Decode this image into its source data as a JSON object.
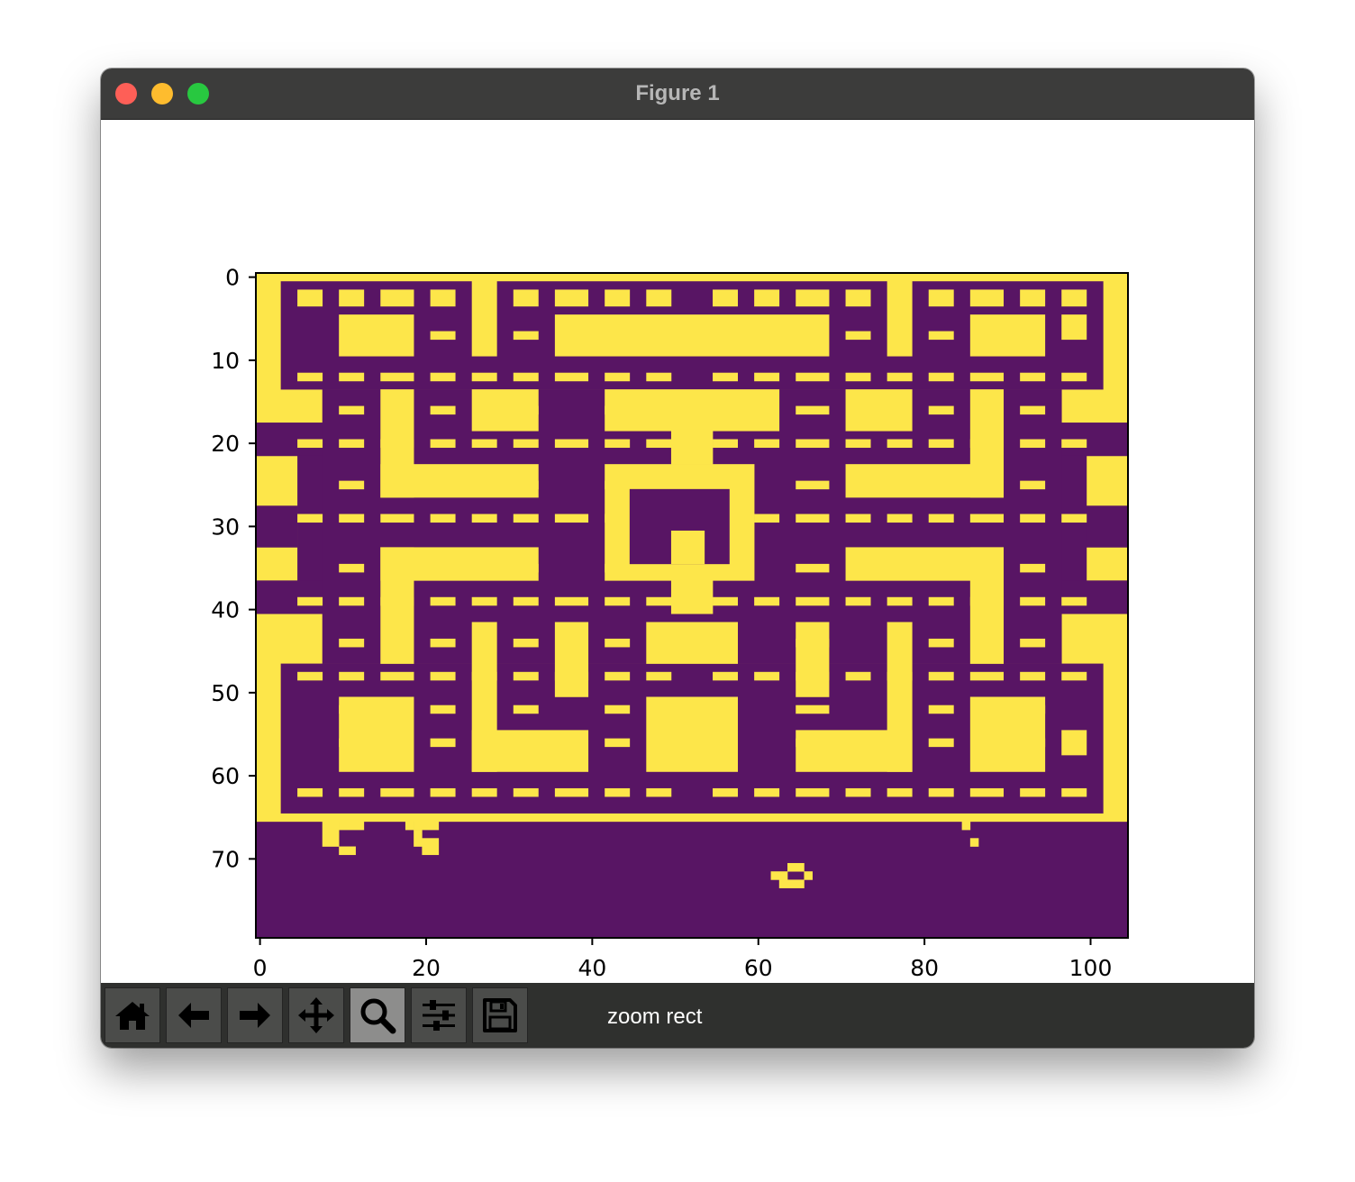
{
  "window": {
    "title": "Figure 1"
  },
  "toolbar": {
    "buttons": [
      {
        "icon": "home-icon",
        "active": false
      },
      {
        "icon": "back-arrow-icon",
        "active": false
      },
      {
        "icon": "forward-arrow-icon",
        "active": false
      },
      {
        "icon": "pan-move-icon",
        "active": false
      },
      {
        "icon": "zoom-magnifier-icon",
        "active": true
      },
      {
        "icon": "configure-subplots-icon",
        "active": false
      },
      {
        "icon": "save-floppy-icon",
        "active": false
      }
    ],
    "status": "zoom rect"
  },
  "chart_data": {
    "type": "heatmap",
    "title": "",
    "xlabel": "",
    "ylabel": "",
    "xlim": [
      -0.5,
      104.5
    ],
    "ylim": [
      79.5,
      -0.5
    ],
    "xticks": [
      0,
      20,
      40,
      60,
      80,
      100
    ],
    "yticks": [
      0,
      10,
      20,
      30,
      40,
      50,
      60,
      70
    ],
    "xtick_labels": [
      "0",
      "20",
      "40",
      "60",
      "80",
      "100"
    ],
    "ytick_labels": [
      "0",
      "10",
      "20",
      "30",
      "40",
      "50",
      "60",
      "70"
    ],
    "colormap": "viridis",
    "value_colors": {
      "0": "#581564",
      "1": "#fde64a"
    },
    "grid": false,
    "rows": 80,
    "cols": 105
  }
}
